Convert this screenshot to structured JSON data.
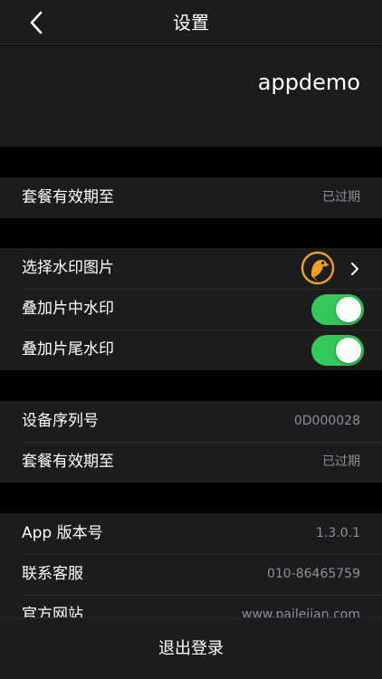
{
  "nav": {
    "title": "设置",
    "back_icon": "chevron-left-icon"
  },
  "account": {
    "name": "appdemo"
  },
  "section1": {
    "rows": [
      {
        "label": "套餐有效期至",
        "value": "已过期"
      }
    ]
  },
  "watermark": {
    "select_label": "选择水印图片",
    "select_icon": "parrot-logo-icon",
    "mid_label": "叠加片中水印",
    "mid_on": true,
    "tail_label": "叠加片尾水印",
    "tail_on": true
  },
  "device": {
    "rows": [
      {
        "label": "设备序列号",
        "value": "0D000028"
      },
      {
        "label": "套餐有效期至",
        "value": "已过期"
      }
    ]
  },
  "about": {
    "rows": [
      {
        "label": "App 版本号",
        "value": "1.3.0.1"
      },
      {
        "label": "联系客服",
        "value": "010-86465759"
      },
      {
        "label": "官方网站",
        "value": "www.pailejian.com"
      }
    ]
  },
  "logout": {
    "label": "退出登录"
  },
  "colors": {
    "background": "#000000",
    "cell": "#1c1c1e",
    "separator": "#2c2c2e",
    "secondary_text": "#8e8e93",
    "toggle_on": "#34c759",
    "logo_orange": "#f0a020"
  }
}
